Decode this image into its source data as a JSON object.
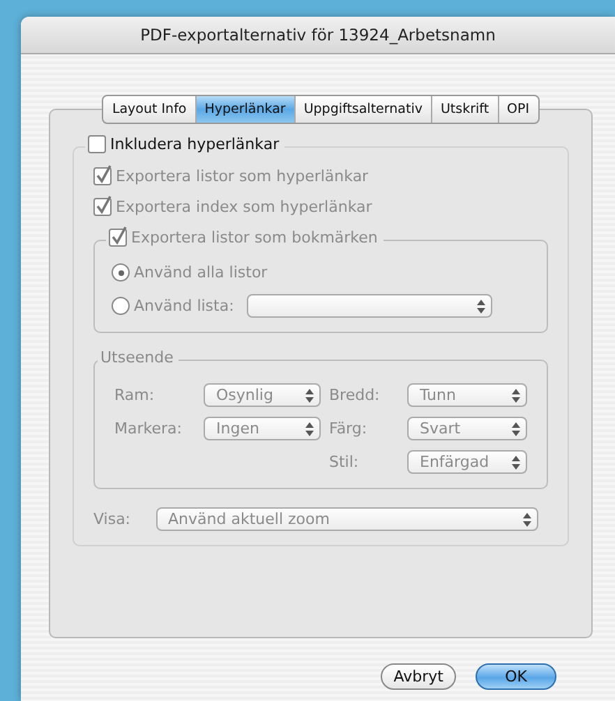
{
  "window": {
    "title": "PDF-exportalternativ för 13924_Arbetsnamn"
  },
  "tabs": [
    {
      "label": "Layout Info",
      "selected": false
    },
    {
      "label": "Hyperlänkar",
      "selected": true
    },
    {
      "label": "Uppgiftsalternativ",
      "selected": false
    },
    {
      "label": "Utskrift",
      "selected": false
    },
    {
      "label": "OPI",
      "selected": false
    }
  ],
  "hyperlinks": {
    "label": "Inkludera hyperlänkar",
    "checked": false,
    "disabled": true,
    "options": [
      {
        "label": "Exportera listor som hyperlänkar",
        "checked": true
      },
      {
        "label": "Exportera index som hyperlänkar",
        "checked": true
      }
    ],
    "bookmarks": {
      "label": "Exportera listor som bokmärken",
      "checked": true,
      "radios": [
        {
          "label": "Använd alla listor",
          "selected": true,
          "kind": "plain"
        },
        {
          "label": "Använd lista:",
          "selected": false,
          "kind": "with_menu"
        }
      ]
    },
    "appearance": {
      "title": "Utseende",
      "rows": [
        {
          "left": {
            "label": "Ram:",
            "value": "Osynlig"
          },
          "right": {
            "label": "Bredd:",
            "value": "Tunn"
          }
        },
        {
          "left": {
            "label": "Markera:",
            "value": "Ingen"
          },
          "right": {
            "label": "Färg:",
            "value": "Svart"
          }
        },
        {
          "right": {
            "label": "Stil:",
            "value": "Enfärgad"
          }
        }
      ]
    },
    "view": {
      "label": "Visa:",
      "value": "Använd aktuell zoom"
    }
  },
  "buttons": [
    {
      "label": "Avbryt",
      "default": false
    },
    {
      "label": "OK",
      "default": true
    }
  ]
}
